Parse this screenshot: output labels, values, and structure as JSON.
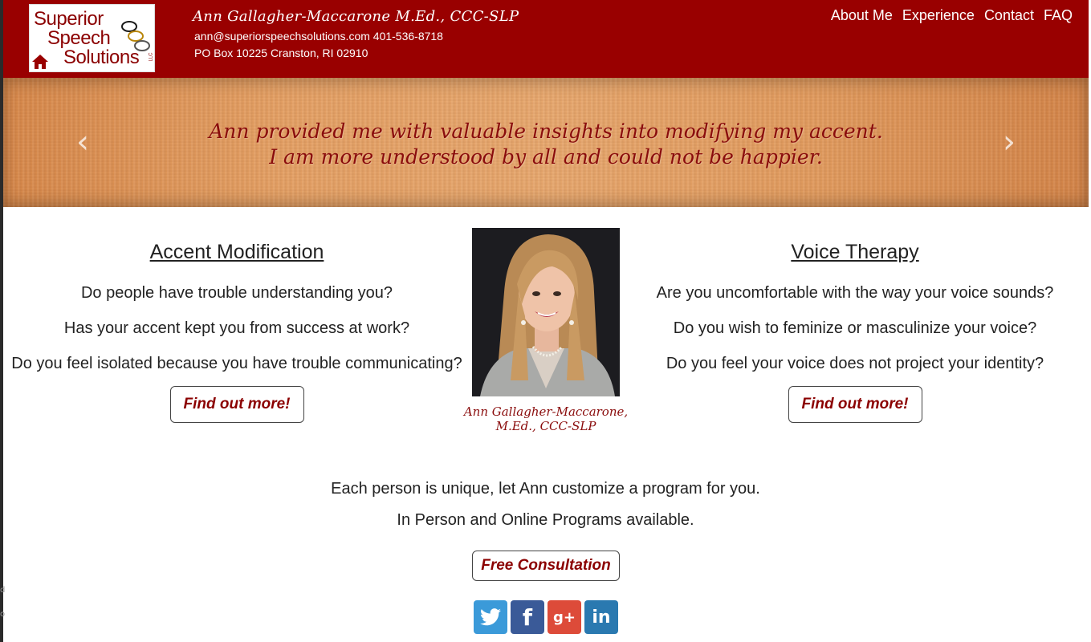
{
  "header": {
    "logo": {
      "line1": "Superior",
      "line2": "Speech",
      "line3": "Solutions",
      "suffix": "LLC"
    },
    "name": "Ann Gallagher-Maccarone M.Ed., CCC-SLP",
    "contact": "ann@superiorspeechsolutions.com 401-536-8718",
    "address": "PO Box 10225 Cranston, RI 02910"
  },
  "nav": {
    "items": [
      "About Me",
      "Experience",
      "Contact",
      "FAQ"
    ]
  },
  "banner": {
    "quote_line1": "Ann provided me with valuable insights into modifying my accent.",
    "quote_line2": "I am more understood by all and could not be happier.",
    "prev_icon": "chevron-left-icon",
    "next_icon": "chevron-right-icon"
  },
  "accent": {
    "title": "Accent Modification",
    "questions": [
      "Do people have trouble understanding you?",
      "Has your accent kept you from success at work?",
      "Do you feel isolated because you have trouble communicating?"
    ],
    "button": "Find out more!"
  },
  "voice": {
    "title": "Voice Therapy",
    "questions": [
      "Are you uncomfortable with the way your voice sounds?",
      "Do you wish to feminize or masculinize your voice?",
      "Do you feel your voice does not project your identity?"
    ],
    "button": "Find out more!"
  },
  "photo": {
    "caption_line1": "Ann Gallagher-Maccarone,",
    "caption_line2": "M.Ed., CCC-SLP"
  },
  "bottom": {
    "tagline1": "Each person is unique, let Ann customize a program for you.",
    "tagline2": "In Person and Online Programs available.",
    "consult_button": "Free Consultation"
  },
  "social": {
    "icons": [
      "twitter-icon",
      "facebook-icon",
      "google-plus-icon",
      "linkedin-icon"
    ],
    "glyphs": {
      "facebook": "f",
      "googleplus": "g+",
      "linkedin": "in"
    }
  },
  "colors": {
    "brand": "#990000",
    "accent_text": "#8b0000"
  }
}
